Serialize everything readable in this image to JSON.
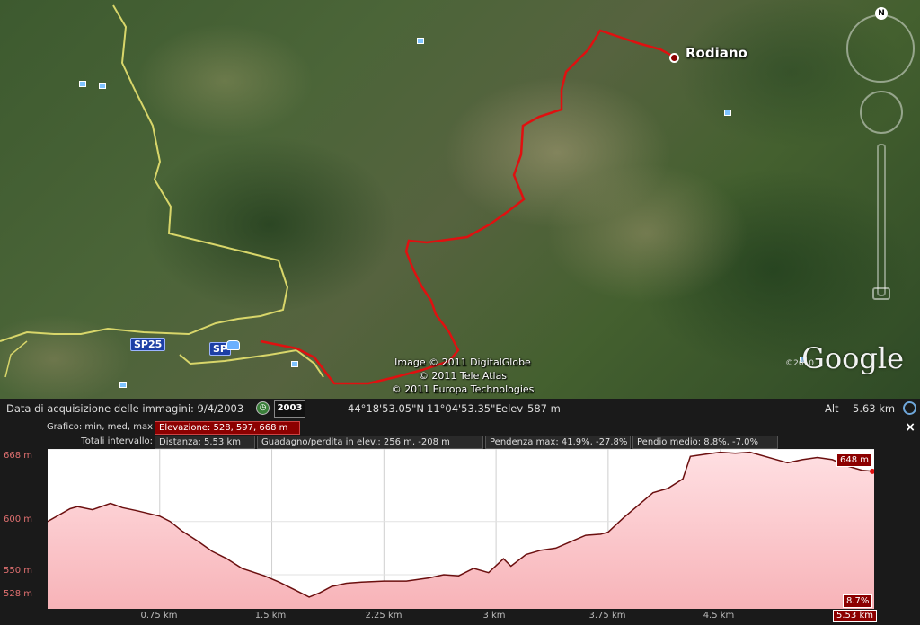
{
  "map": {
    "place_label": "Rodiano",
    "road_badges": [
      "SP25",
      "SP"
    ],
    "copyright_lines": [
      "Image © 2011 DigitalGlobe",
      "© 2011 Tele Atlas",
      "© 2011 Europa Technologies"
    ],
    "google_logo": "Google",
    "google_year": "©2010",
    "north_label": "N",
    "colors": {
      "route": "#e01010",
      "road": "#d8d66a"
    }
  },
  "status_bar": {
    "imagery_date": "Data di acquisizione delle immagini: 9/4/2003",
    "year_button": "2003",
    "latitude": "44°18'53.05\"N",
    "longitude": "11°04'53.35\"E",
    "elev_label": "elev",
    "elev_value": "587 m",
    "alt_label": "Alt",
    "alt_value": "5.63 km"
  },
  "elevation_panel": {
    "close_label": "×",
    "graph_label": "Grafico: min, med, max",
    "elevation_summary": "Elevazione: 528, 597, 668 m",
    "totals_label": "Totali intervallo:",
    "distance": "Distanza: 5.53 km",
    "gain_loss": "Guadagno/perdita in elev.: 256 m, -208 m",
    "max_slope": "Pendenza max: 41.9%, -27.8%",
    "avg_slope": "Pendio medio: 8.8%, -7.0%",
    "cursor_elevation": "648 m",
    "cursor_grade": "8.7%",
    "end_distance": "5.53 km",
    "colors": {
      "accent": "#8c0000",
      "fill": "#f7b3b8",
      "line": "#6b0f0f"
    }
  },
  "chart_data": {
    "type": "area",
    "xlabel": "",
    "ylabel": "",
    "x_ticks": [
      "0.75 km",
      "1.5 km",
      "2.25 km",
      "3 km",
      "3.75 km",
      "4.5 km"
    ],
    "y_ticks": [
      "668 m",
      "600 m",
      "550 m",
      "528 m"
    ],
    "xlim": [
      0,
      5.53
    ],
    "ylim": [
      518,
      668
    ],
    "x": [
      0,
      0.15,
      0.2,
      0.3,
      0.42,
      0.5,
      0.6,
      0.75,
      0.82,
      0.9,
      1.0,
      1.1,
      1.2,
      1.3,
      1.45,
      1.55,
      1.65,
      1.75,
      1.82,
      1.9,
      2.0,
      2.1,
      2.25,
      2.4,
      2.55,
      2.65,
      2.75,
      2.85,
      2.95,
      3.05,
      3.1,
      3.2,
      3.3,
      3.4,
      3.5,
      3.6,
      3.7,
      3.75,
      3.85,
      3.95,
      4.05,
      4.15,
      4.25,
      4.3,
      4.4,
      4.5,
      4.6,
      4.7,
      4.85,
      4.95,
      5.05,
      5.15,
      5.25,
      5.35,
      5.45,
      5.53
    ],
    "y": [
      600,
      612,
      614,
      611,
      617,
      613,
      610,
      605,
      600,
      591,
      582,
      572,
      565,
      556,
      549,
      543,
      536,
      529,
      533,
      539,
      542,
      543,
      544,
      544,
      547,
      550,
      549,
      556,
      552,
      565,
      558,
      569,
      573,
      575,
      581,
      587,
      588,
      590,
      603,
      615,
      627,
      631,
      640,
      661,
      663,
      665,
      664,
      665,
      659,
      655,
      658,
      660,
      658,
      652,
      648,
      647
    ]
  }
}
